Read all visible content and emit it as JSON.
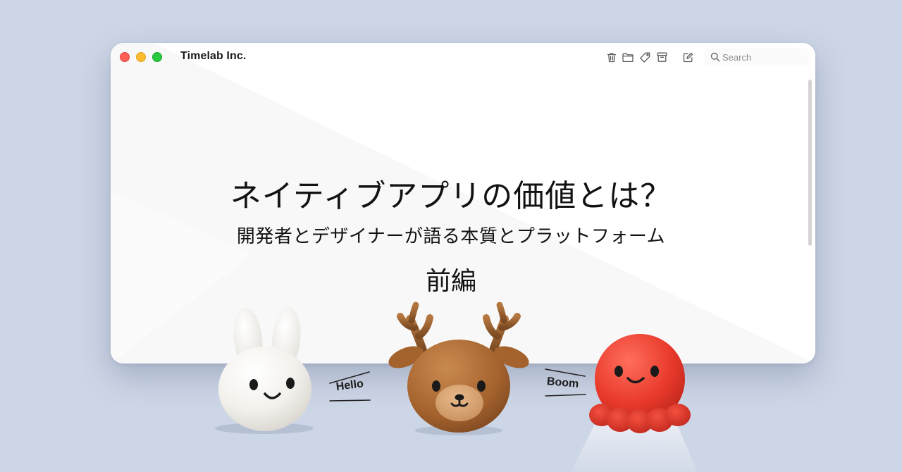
{
  "window": {
    "title": "Timelab Inc.",
    "traffic_lights": [
      "close",
      "minimize",
      "maximize"
    ],
    "toolbar_icons": [
      "trash-icon",
      "folder-icon",
      "tag-icon",
      "archive-icon",
      "compose-icon"
    ],
    "search": {
      "placeholder": "Search",
      "value": ""
    }
  },
  "headline": {
    "title": "ネイティブアプリの価値とは？",
    "subtitle": "開発者とデザイナーが語る本質とプラットフォーム",
    "part": "前編"
  },
  "characters": [
    {
      "name": "rabbit",
      "speech": "Hello"
    },
    {
      "name": "deer",
      "speech": ""
    },
    {
      "name": "octopus",
      "speech": "Boom"
    }
  ],
  "colors": {
    "background": "#cdd6e6",
    "window": "#ffffff",
    "close": "#ff5f57",
    "minimize": "#febc2e",
    "maximize": "#28c840",
    "octopus": "#e8392b",
    "deer": "#a4622d",
    "rabbit": "#f4f2ee"
  }
}
